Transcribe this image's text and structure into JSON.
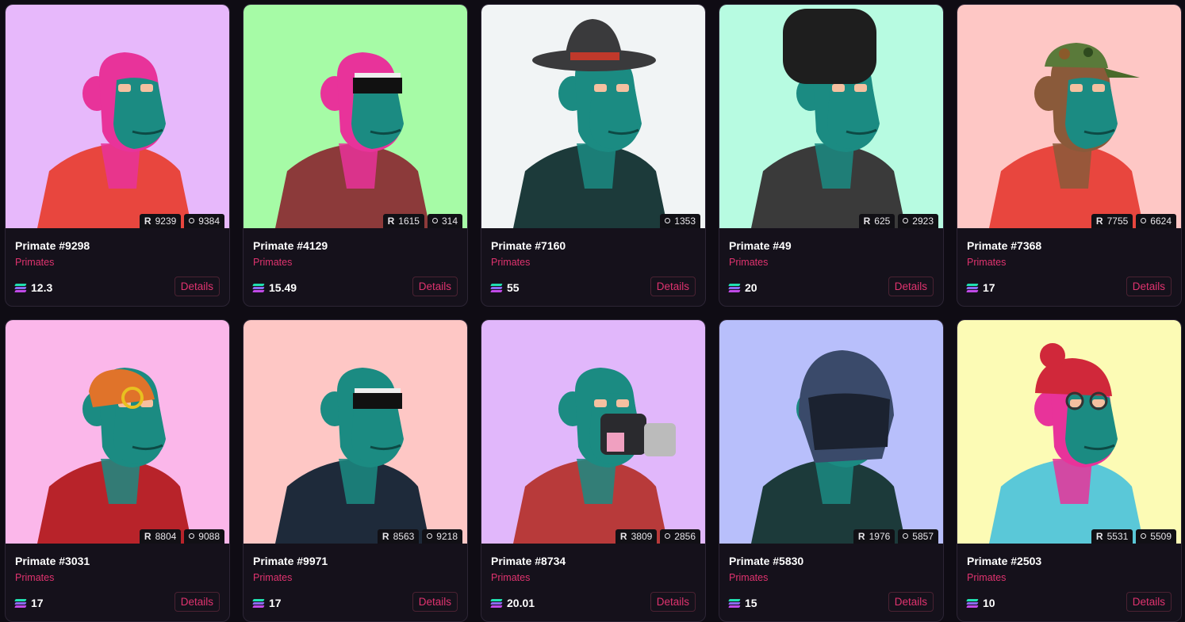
{
  "cards": [
    {
      "name": "Primate #9298",
      "collection": "Primates",
      "price": "12.3",
      "stat_a": "9239",
      "stat_b": "9384",
      "bg": "#e7b8fb",
      "skin": "#e8339a",
      "outfit": "#e8463e",
      "headwear": "none",
      "details": "Details"
    },
    {
      "name": "Primate #4129",
      "collection": "Primates",
      "price": "15.49",
      "stat_a": "1615",
      "stat_b": "314",
      "bg": "#a6fba6",
      "skin": "#e8339a",
      "outfit": "#8c3a3a",
      "headwear": "censored",
      "details": "Details"
    },
    {
      "name": "Primate #7160",
      "collection": "Primates",
      "price": "55",
      "stat_a": "",
      "stat_b": "1353",
      "bg": "#f1f4f5",
      "skin": "#1b8b82",
      "outfit": "#1c3a3a",
      "headwear": "cowboy-hat",
      "details": "Details"
    },
    {
      "name": "Primate #49",
      "collection": "Primates",
      "price": "20",
      "stat_a": "625",
      "stat_b": "2923",
      "bg": "#b7fbe1",
      "skin": "#1b8b82",
      "outfit": "#3a3a3a",
      "headwear": "fur-hat",
      "details": "Details"
    },
    {
      "name": "Primate #7368",
      "collection": "Primates",
      "price": "17",
      "stat_a": "7755",
      "stat_b": "6624",
      "bg": "#fec7c5",
      "skin": "#8a5a3a",
      "outfit": "#e8463e",
      "headwear": "camo-cap",
      "details": "Details"
    },
    {
      "name": "Primate #3031",
      "collection": "Primates",
      "price": "17",
      "stat_a": "8804",
      "stat_b": "9088",
      "bg": "#fbb7ea",
      "skin": "#1b8b82",
      "outfit": "#b8232a",
      "headwear": "tiger",
      "details": "Details"
    },
    {
      "name": "Primate #9971",
      "collection": "Primates",
      "price": "17",
      "stat_a": "8563",
      "stat_b": "9218",
      "bg": "#fec7c5",
      "skin": "#1b8b82",
      "outfit": "#1e2a3a",
      "headwear": "censored",
      "details": "Details"
    },
    {
      "name": "Primate #8734",
      "collection": "Primates",
      "price": "20.01",
      "stat_a": "3809",
      "stat_b": "2856",
      "bg": "#e1b7fb",
      "skin": "#1b8b82",
      "outfit": "#b83a3a",
      "headwear": "gas-mask",
      "details": "Details"
    },
    {
      "name": "Primate #5830",
      "collection": "Primates",
      "price": "15",
      "stat_a": "1976",
      "stat_b": "5857",
      "bg": "#b8bffb",
      "skin": "#1b8b82",
      "outfit": "#1c3a3a",
      "headwear": "helmet",
      "details": "Details"
    },
    {
      "name": "Primate #2503",
      "collection": "Primates",
      "price": "10",
      "stat_a": "5531",
      "stat_b": "5509",
      "bg": "#fcfbb5",
      "skin": "#e8339a",
      "outfit": "#5ac8d8",
      "headwear": "beanie",
      "details": "Details"
    }
  ],
  "icons": {
    "stat_a": "rarity-r-icon",
    "stat_b": "views-ring-icon",
    "price": "solana-icon"
  },
  "colors": {
    "accent": "#e0336f",
    "card_bg": "#15111b",
    "page_bg": "#0f0c14"
  }
}
